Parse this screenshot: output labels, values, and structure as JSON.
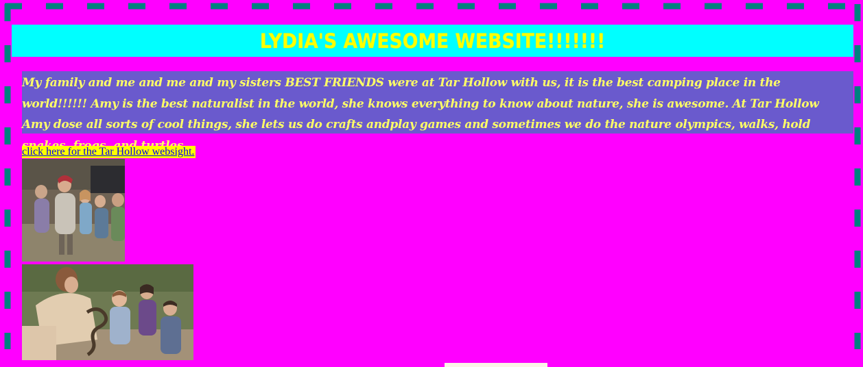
{
  "page": {
    "title": "LYDIA'S AWESOME WEBSITE!!!!!!!",
    "paragraph": "My family and me and me and my sisters BEST FRIENDS were at Tar Hollow with us, it is the best camping place in the world!!!!!! Amy is the best naturalist in the world, she knows everything to know about nature, she is awesome. At Tar Hollow Amy dose all sorts of cool things, she lets us do crafts andplay games and sometimes we do the nature olympics, walks, hold snakes, frogs, and turtles.",
    "link_text": "click here for the Tar Hollow websight."
  },
  "colors": {
    "background": "#ff00ff",
    "border_dash": "#008080",
    "header_bg": "#00ffff",
    "title_color": "#ffff00",
    "paragraph_bg": "#6a5acd",
    "paragraph_text": "#ffff66",
    "link_bg": "#ffff00",
    "link_color": "#0000ee"
  },
  "images": [
    {
      "name": "group-photo",
      "description": "photo of a woman with four girls outdoors"
    },
    {
      "name": "snake-photo",
      "description": "photo of a woman showing a snake to children"
    }
  ]
}
